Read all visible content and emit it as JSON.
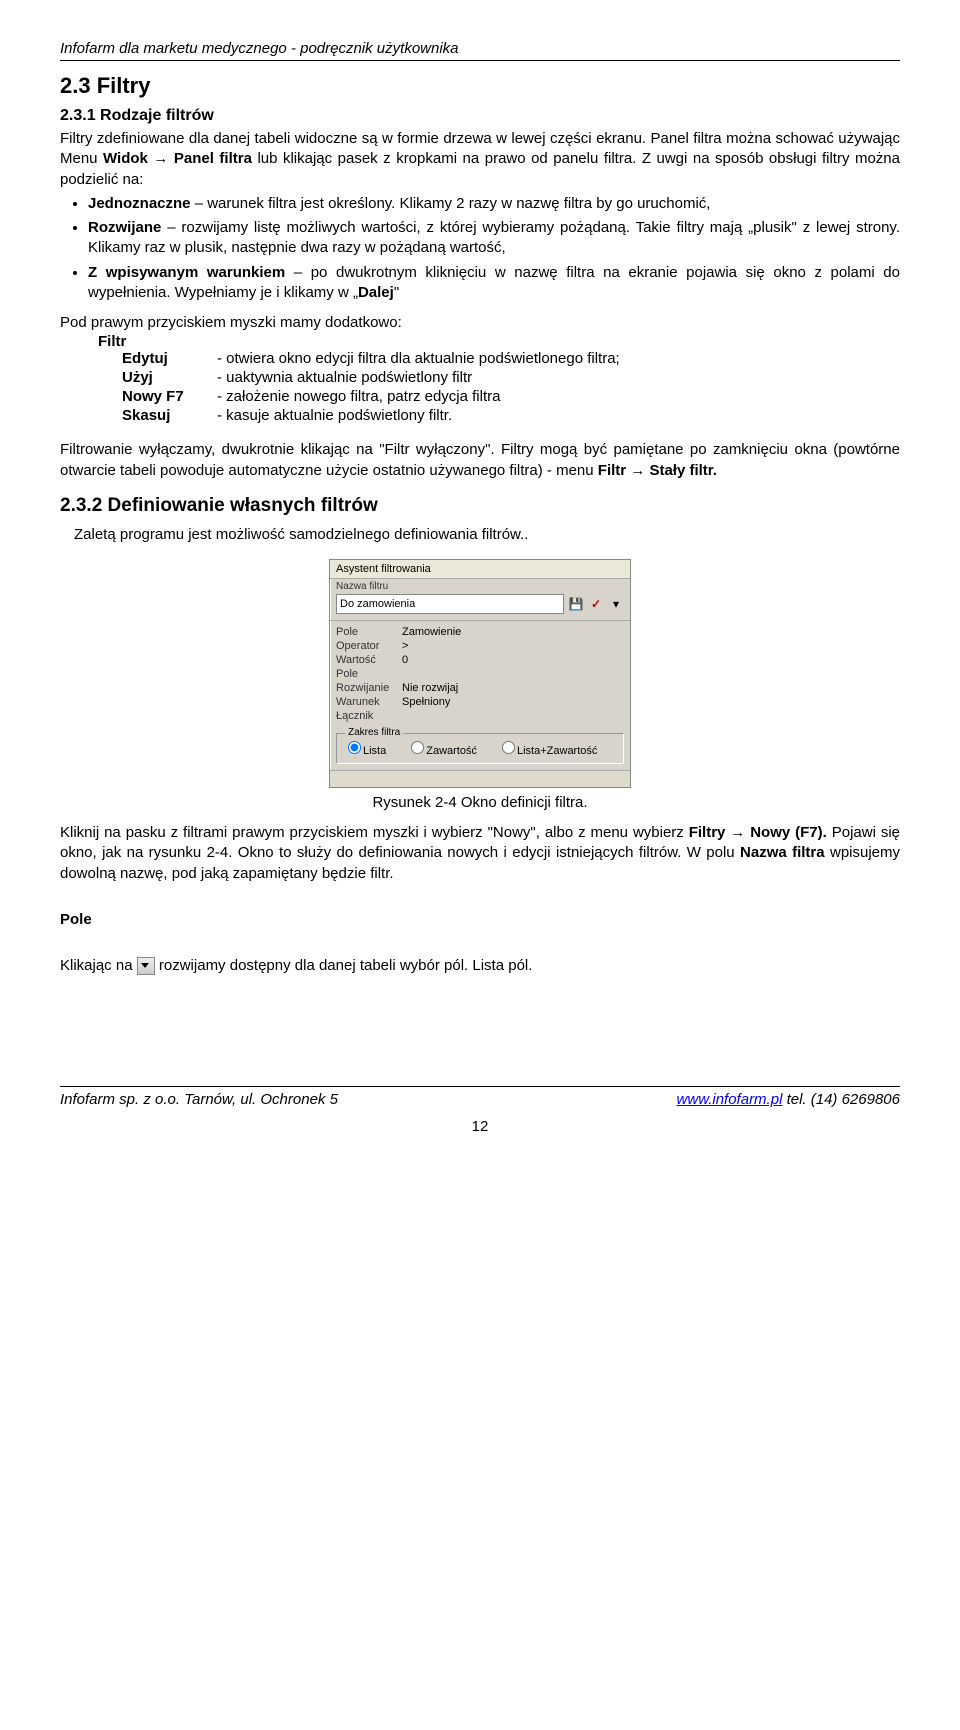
{
  "header": "Infofarm dla marketu medycznego - podręcznik użytkownika",
  "section23": {
    "num_title": "2.3  Filtry",
    "sub231_title": "2.3.1  Rodzaje filtrów",
    "p1a": "Filtry zdefiniowane dla danej tabeli widoczne są w formie drzewa w lewej części ekranu. Panel filtra można schować używając Menu ",
    "p1b": "Widok → Panel filtra",
    "p1c": " lub klikając pasek z kropkami na prawo od panelu filtra. Z uwgi na sposób obsługi filtry można podzielić na:",
    "li1a": "Jednoznaczne",
    "li1b": " – warunek filtra jest określony. Klikamy 2 razy w nazwę filtra by go uruchomić,",
    "li2a": "Rozwijane",
    "li2b": " – rozwijamy listę możliwych wartości, z której wybieramy pożądaną. Takie filtry mają „plusik\" z lewej strony. Klikamy raz w plusik, następnie dwa razy w pożądaną wartość,",
    "li3a": "Z wpisywanym warunkiem",
    "li3b": " – po dwukrotnym kliknięciu w nazwę filtra na ekranie pojawia się okno z polami do wypełnienia. Wypełniamy je i klikamy w „",
    "li3c": "Dalej",
    "li3d": "\"",
    "p2": "Pod prawym przyciskiem myszki mamy dodatkowo:",
    "filtr_label": "Filtr",
    "menu": {
      "edytuj": "Edytuj",
      "edytuj_d": "- otwiera okno edycji filtra dla aktualnie podświetlonego filtra;",
      "uzyj": "Użyj",
      "uzyj_d": "- uaktywnia aktualnie podświetlony filtr",
      "nowy": "Nowy F7",
      "nowy_d": "- założenie nowego filtra, patrz edycja filtra",
      "skasuj": "Skasuj",
      "skasuj_d": "- kasuje aktualnie podświetlony filtr."
    },
    "p3a": "Filtrowanie wyłączamy, dwukrotnie klikając na \"Filtr wyłączony\". Filtry mogą być pamiętane po zamknięciu okna (powtórne otwarcie tabeli powoduje automatyczne użycie ostatnio używanego filtra) - menu ",
    "p3b": "Filtr → Stały filtr.",
    "sub232_title": "2.3.2  Definiowanie własnych filtrów",
    "p4": "Zaletą programu jest możliwość samodzielnego definiowania filtrów..",
    "figcap": "Rysunek 2-4 Okno definicji filtra.",
    "p5a": "Kliknij na pasku z filtrami prawym przyciskiem myszki i wybierz \"Nowy\", albo z menu wybierz ",
    "p5b": "Filtry → Nowy (F7).",
    "p5c": " Pojawi się okno, jak na rysunku 2-4. Okno to służy do definiowania nowych i edycji istniejących filtrów. W polu ",
    "p5d": "Nazwa filtra",
    "p5e": " wpisujemy dowolną nazwę, pod jaką zapamiętany będzie filtr.",
    "pole_heading": "Pole",
    "p6a": "Klikając na ",
    "p6b": " rozwijamy dostępny dla danej tabeli wybór pól. Lista pól."
  },
  "mock": {
    "title": "Asystent filtrowania",
    "nazwa_label": "Nazwa filtru",
    "nazwa_value": "Do zamowienia",
    "rows": [
      {
        "lbl": "Pole",
        "val": "Zamowienie"
      },
      {
        "lbl": "Operator",
        "val": ">"
      },
      {
        "lbl": "Wartość",
        "val": "0"
      },
      {
        "lbl": "Pole",
        "val": ""
      },
      {
        "lbl": "Rozwijanie",
        "val": "Nie rozwijaj"
      },
      {
        "lbl": "Warunek",
        "val": "Spełniony"
      },
      {
        "lbl": "Łącznik",
        "val": ""
      }
    ],
    "zakres_legend": "Zakres filtra",
    "radio": {
      "lista": "Lista",
      "zaw": "Zawartość",
      "lz": "Lista+Zawartość"
    }
  },
  "footer": {
    "left": "Infofarm sp. z o.o.  Tarnów, ul. Ochronek 5",
    "link": "www.infofarm.pl",
    "right_after": " tel. (14) 6269806",
    "pagenum": "12"
  }
}
